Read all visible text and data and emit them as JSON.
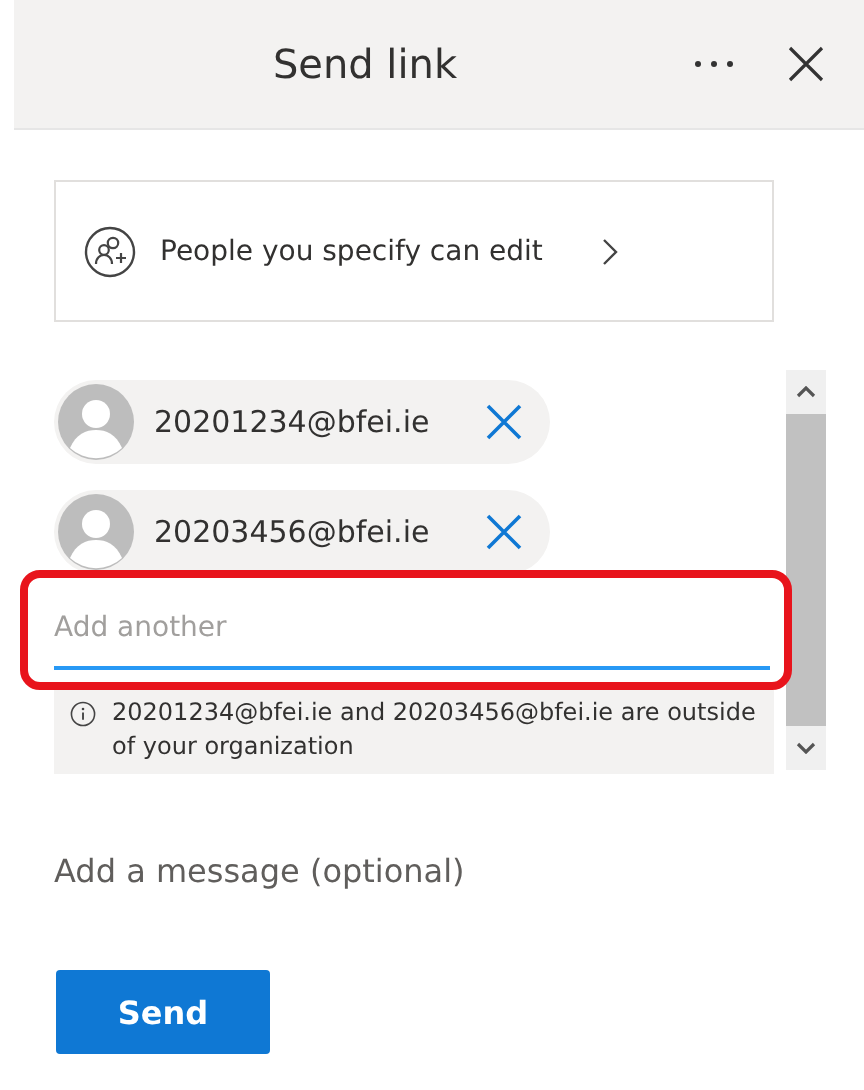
{
  "header": {
    "title": "Send link"
  },
  "permission": {
    "label": "People you specify can edit"
  },
  "recipients": [
    {
      "email": "20201234@bfei.ie"
    },
    {
      "email": "20203456@bfei.ie"
    }
  ],
  "recipient_input": {
    "placeholder": "Add another",
    "highlighted": true
  },
  "notice": {
    "text": "20201234@bfei.ie and 20203456@bfei.ie are outside of your organization"
  },
  "message": {
    "placeholder": "Add a message (optional)"
  },
  "send_button": {
    "label": "Send"
  }
}
